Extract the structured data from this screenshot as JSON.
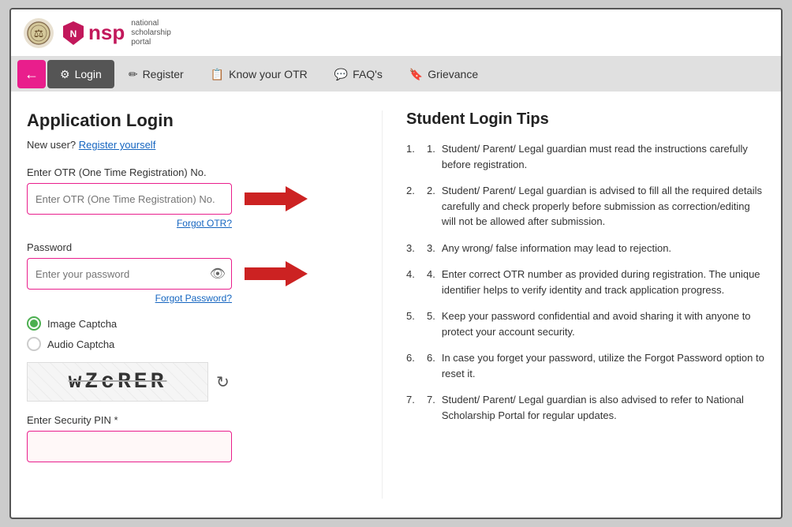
{
  "header": {
    "emblem_text": "🏛",
    "nsp_text": "nsp",
    "nsp_subtitle_line1": "national",
    "nsp_subtitle_line2": "scholarship",
    "nsp_subtitle_line3": "portal"
  },
  "nav": {
    "back_label": "←",
    "items": [
      {
        "id": "login",
        "label": "Login",
        "active": true,
        "icon": "⚙"
      },
      {
        "id": "register",
        "label": "Register",
        "active": false,
        "icon": "✏"
      },
      {
        "id": "know-otr",
        "label": "Know your OTR",
        "active": false,
        "icon": "📋"
      },
      {
        "id": "faq",
        "label": "FAQ's",
        "active": false,
        "icon": "💬"
      },
      {
        "id": "grievance",
        "label": "Grievance",
        "active": false,
        "icon": "🔖"
      }
    ]
  },
  "left": {
    "title": "Application Login",
    "new_user_prompt": "New user?",
    "register_link": "Register yourself",
    "otr_label": "Enter OTR (One Time Registration) No.",
    "otr_placeholder": "Enter OTR (One Time Registration) No.",
    "forgot_otr": "Forgot OTR?",
    "password_label": "Password",
    "password_placeholder": "Enter your password",
    "forgot_password": "Forgot Password?",
    "captcha_image_label": "Image Captcha",
    "captcha_audio_label": "Audio Captcha",
    "captcha_code": "wZcRER",
    "security_pin_label": "Enter Security PIN *"
  },
  "tips": {
    "title": "Student Login Tips",
    "items": [
      "Student/ Parent/ Legal guardian must read the instructions carefully before registration.",
      "Student/ Parent/ Legal guardian is advised to fill all the required details carefully and check properly before submission as correction/editing will not be allowed after submission.",
      "Any wrong/ false information may lead to rejection.",
      "Enter correct OTR number as provided during registration. The unique identifier helps to verify identity and track application progress.",
      "Keep your password confidential and avoid sharing it with anyone to protect your account security.",
      "In case you forget your password, utilize the Forgot Password option to reset it.",
      "Student/ Parent/ Legal guardian is also advised to refer to National Scholarship Portal for regular updates."
    ]
  }
}
